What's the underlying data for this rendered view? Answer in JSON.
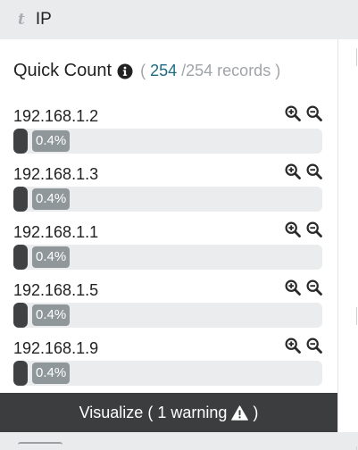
{
  "field": {
    "type_glyph": "t",
    "name": "IP"
  },
  "quick_count": {
    "title": "Quick Count",
    "open_paren": "(",
    "count": "254",
    "total_text": "/254 records )"
  },
  "items": [
    {
      "label": "192.168.1.2",
      "percent_text": "0.4%",
      "fraction": 0.004
    },
    {
      "label": "192.168.1.3",
      "percent_text": "0.4%",
      "fraction": 0.004
    },
    {
      "label": "192.168.1.1",
      "percent_text": "0.4%",
      "fraction": 0.004
    },
    {
      "label": "192.168.1.5",
      "percent_text": "0.4%",
      "fraction": 0.004
    },
    {
      "label": "192.168.1.9",
      "percent_text": "0.4%",
      "fraction": 0.004
    }
  ],
  "visualize": {
    "label_before": "Visualize ( 1 warning",
    "label_after": ")"
  },
  "icons": {
    "info": "info-circle-icon",
    "zoom_in": "zoom-in-icon",
    "zoom_out": "zoom-out-icon",
    "warning": "warning-triangle-icon"
  },
  "colors": {
    "count_accent": "#1e6b82",
    "bar_fill": "#3f4143",
    "pct_badge": "#8f979b",
    "visualize_bg": "#3c3d3e"
  }
}
